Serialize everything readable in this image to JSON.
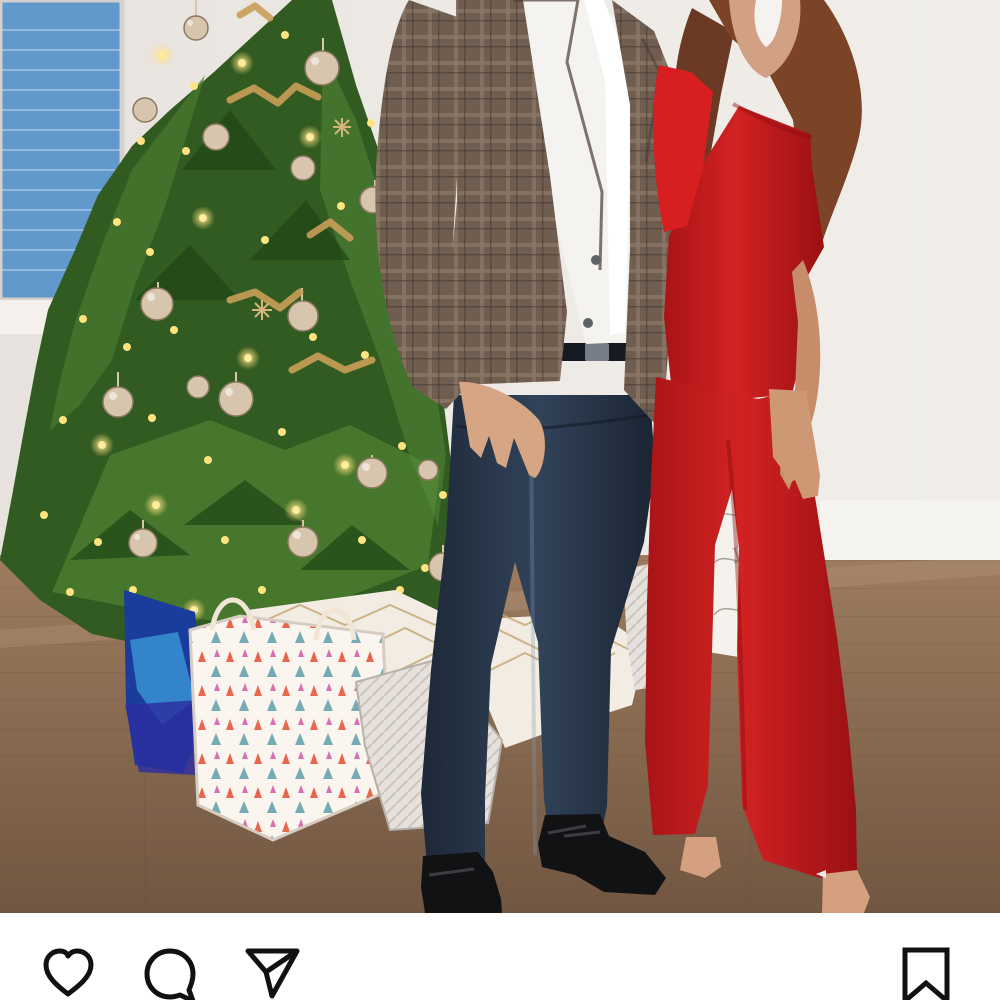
{
  "post": {
    "actions": {
      "like": "heart-icon",
      "comment": "comment-bubble-icon",
      "share": "paper-plane-icon",
      "save": "bookmark-icon"
    }
  },
  "colors": {
    "wall": "#ece8e4",
    "floor": "#8b6d52",
    "tree": "#3e6a2a",
    "jumpsuit": "#c81d1f",
    "blazer": "#6f5b4c",
    "jeans": "#253446",
    "icon": "#111111"
  }
}
